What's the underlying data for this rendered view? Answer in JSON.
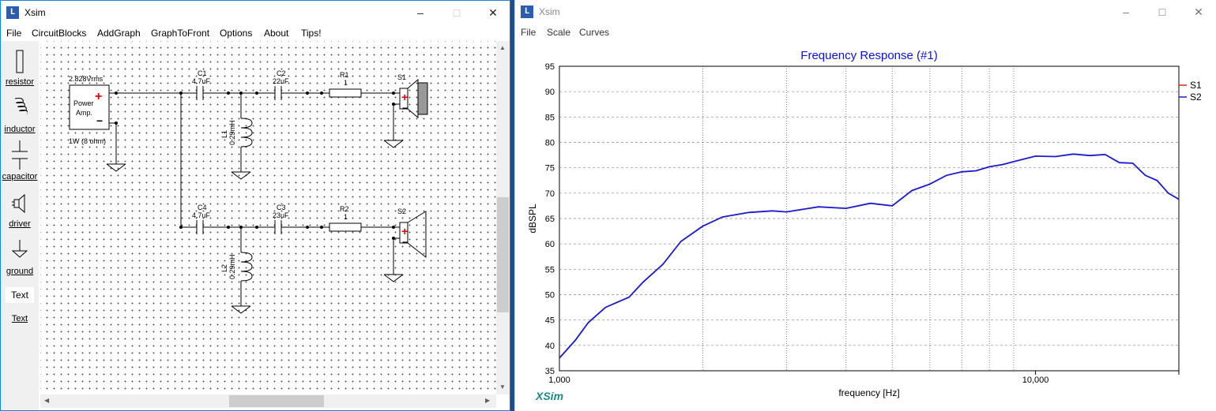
{
  "left_window": {
    "title": "Xsim",
    "menu": [
      "File",
      "CircuitBlocks",
      "AddGraph",
      "GraphToFront",
      "Options",
      "About",
      "Tips!"
    ],
    "tools": [
      {
        "label": "resistor",
        "icon": "resistor-icon"
      },
      {
        "label": "inductor",
        "icon": "inductor-icon"
      },
      {
        "label": "capacitor",
        "icon": "capacitor-icon"
      },
      {
        "label": "driver",
        "icon": "driver-icon"
      },
      {
        "label": "ground",
        "icon": "ground-icon"
      },
      {
        "label": "Text",
        "icon": "text-icon"
      },
      {
        "label": "Text",
        "icon": "text-link"
      }
    ],
    "schematic": {
      "amp_voltage": "2.828Vrms",
      "amp_label1": "Power",
      "amp_label2": "Amp.",
      "amp_power": "1W (8 ohm)",
      "C1_name": "C1",
      "C1_value": "4.7uF",
      "C2_name": "C2",
      "C2_value": "22uF",
      "R1_name": "R1",
      "R1_value": "1",
      "S1_name": "S1",
      "L1_name": "L1",
      "L1_value": "0.29mH",
      "C4_name": "C4",
      "C4_value": "4.7uF",
      "C3_name": "C3",
      "C3_value": "23uF",
      "R2_name": "R2",
      "R2_value": "1",
      "S2_name": "S2",
      "L2_name": "L2",
      "L2_value": "0.29mH"
    }
  },
  "right_window": {
    "title": "Xsim",
    "menu": [
      "File",
      "Scale",
      "Curves"
    ],
    "watermark": "XSim"
  },
  "chart_data": {
    "type": "line",
    "title": "Frequency Response (#1)",
    "xlabel": "frequency [Hz]",
    "ylabel": "dBSPL",
    "x_scale": "log",
    "xlim": [
      1000,
      20000
    ],
    "ylim": [
      35,
      95
    ],
    "x_tick_labels": [
      "1,000",
      "10,000"
    ],
    "y_ticks": [
      35,
      40,
      45,
      50,
      55,
      60,
      65,
      70,
      75,
      80,
      85,
      90,
      95
    ],
    "grid": true,
    "legend_position": "right",
    "series": [
      {
        "name": "S1",
        "color": "#e02020",
        "x": [],
        "y": []
      },
      {
        "name": "S2",
        "color": "#1a1ad0",
        "x": [
          1000,
          1080,
          1150,
          1250,
          1400,
          1500,
          1650,
          1800,
          2000,
          2200,
          2500,
          2800,
          3000,
          3500,
          4000,
          4500,
          5000,
          5500,
          6000,
          6500,
          7000,
          7500,
          8000,
          8500,
          9000,
          10000,
          11000,
          12000,
          13000,
          14000,
          15000,
          16000,
          17000,
          18000,
          19000,
          20000
        ],
        "y": [
          37.5,
          41,
          44.5,
          47.5,
          49.5,
          52.5,
          56,
          60.5,
          63.5,
          65.3,
          66.2,
          66.5,
          66.3,
          67.3,
          67,
          68,
          67.5,
          70.5,
          71.8,
          73.5,
          74.2,
          74.4,
          75.2,
          75.6,
          76.2,
          77.3,
          77.2,
          77.7,
          77.4,
          77.6,
          76,
          75.9,
          73.5,
          72.5,
          70,
          68.8
        ]
      }
    ]
  }
}
